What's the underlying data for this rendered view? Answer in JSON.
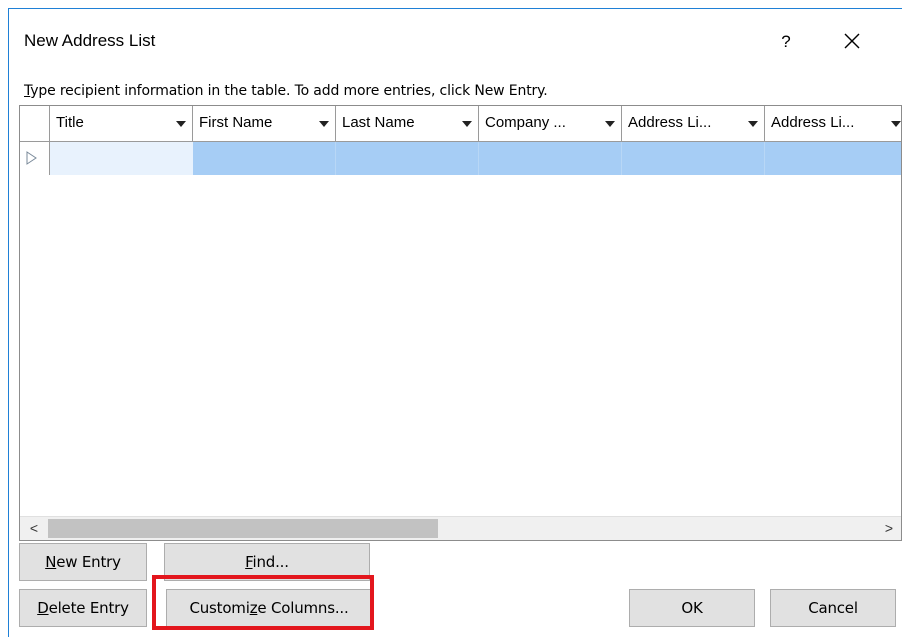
{
  "window": {
    "title": "New Address List",
    "help_label": "?",
    "close_icon": "close-icon"
  },
  "instructions": {
    "first_letter": "T",
    "rest": "ype recipient information in the table.  To add more entries, click New Entry."
  },
  "table": {
    "columns": [
      {
        "label": "Title"
      },
      {
        "label": "First Name"
      },
      {
        "label": "Last Name"
      },
      {
        "label": "Company ..."
      },
      {
        "label": "Address Li..."
      },
      {
        "label": "Address Li..."
      }
    ],
    "rows": [
      {
        "cells": [
          "",
          "",
          "",
          "",
          "",
          ""
        ]
      }
    ],
    "scroll_left_glyph": "<",
    "scroll_right_glyph": ">"
  },
  "buttons": {
    "new_entry": {
      "acc": "N",
      "rest": "ew Entry"
    },
    "find": {
      "acc": "F",
      "rest": "ind..."
    },
    "delete_entry": {
      "acc": "D",
      "rest": "elete Entry"
    },
    "customize_columns": {
      "pre": "Customi",
      "acc": "z",
      "rest": "e Columns..."
    },
    "ok": "OK",
    "cancel": "Cancel"
  },
  "colors": {
    "selected_row": "#a6cdf5",
    "active_cell": "#e8f2fd",
    "window_border": "#1f80d6",
    "highlight": "#e3161d"
  }
}
